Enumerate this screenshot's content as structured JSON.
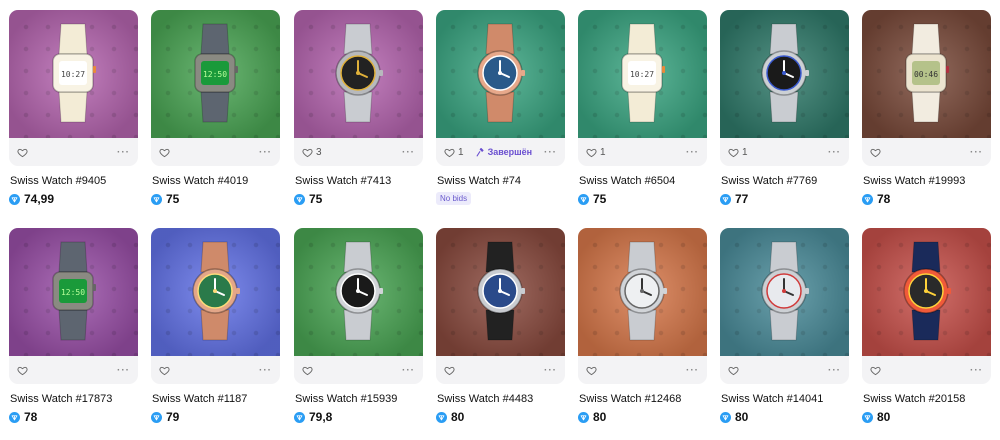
{
  "items": [
    {
      "name": "Swiss Watch #9405",
      "price": "74,99",
      "likes": "",
      "bg": "#b665b0",
      "watch": "digital-white",
      "screen": "10:27"
    },
    {
      "name": "Swiss Watch #4019",
      "price": "75",
      "likes": "",
      "bg": "#4aa654",
      "watch": "digital-gray",
      "screen": "12:50"
    },
    {
      "name": "Swiss Watch #7413",
      "price": "75",
      "likes": "3",
      "bg": "#b665b0",
      "watch": "skeleton",
      "screen": ""
    },
    {
      "name": "Swiss Watch #74",
      "price": "",
      "likes": "1",
      "status": "Завершён",
      "badge": "No bids",
      "bg": "#3aa682",
      "watch": "rose-diamond",
      "screen": ""
    },
    {
      "name": "Swiss Watch #6504",
      "price": "75",
      "likes": "1",
      "bg": "#3aa682",
      "watch": "digital-white",
      "screen": "10:27"
    },
    {
      "name": "Swiss Watch #7769",
      "price": "77",
      "likes": "1",
      "bg": "#2f7a6a",
      "watch": "diver-blue",
      "screen": ""
    },
    {
      "name": "Swiss Watch #19993",
      "price": "78",
      "likes": "",
      "bg": "#7a4a3a",
      "watch": "gameboy",
      "screen": "00:46"
    },
    {
      "name": "Swiss Watch #17873",
      "price": "78",
      "likes": "",
      "bg": "#9a4fa8",
      "watch": "digital-gray",
      "screen": "12:50"
    },
    {
      "name": "Swiss Watch #1187",
      "price": "79",
      "likes": "",
      "bg": "#6272e8",
      "watch": "rose-green",
      "screen": ""
    },
    {
      "name": "Swiss Watch #15939",
      "price": "79,8",
      "likes": "",
      "bg": "#4aa654",
      "watch": "steel-black",
      "screen": ""
    },
    {
      "name": "Swiss Watch #4483",
      "price": "80",
      "likes": "",
      "bg": "#8a4a3e",
      "watch": "square-blue",
      "screen": ""
    },
    {
      "name": "Swiss Watch #12468",
      "price": "80",
      "likes": "",
      "bg": "#d8784a",
      "watch": "steel-white",
      "screen": ""
    },
    {
      "name": "Swiss Watch #14041",
      "price": "80",
      "likes": "",
      "bg": "#4a8c9a",
      "watch": "pepsi",
      "screen": ""
    },
    {
      "name": "Swiss Watch #20158",
      "price": "80",
      "likes": "",
      "bg": "#c8504a",
      "watch": "neon-red",
      "screen": ""
    }
  ],
  "colors": {
    "ton": "#2a9df4",
    "accent": "#6a4fd0"
  }
}
